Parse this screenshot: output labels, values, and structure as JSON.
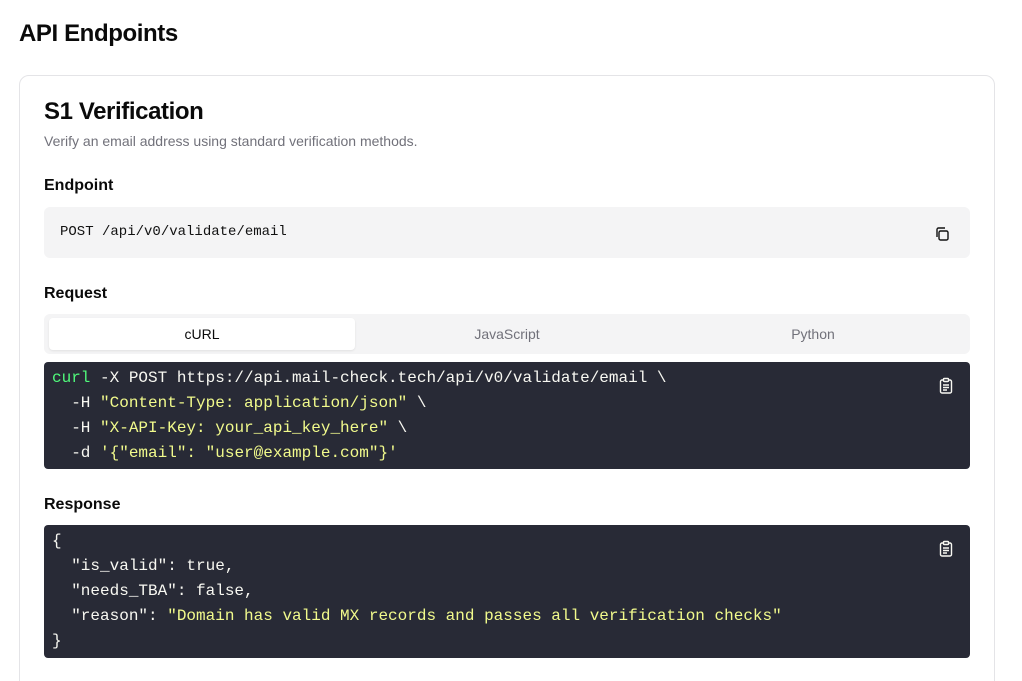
{
  "page": {
    "title": "API Endpoints"
  },
  "card": {
    "title": "S1 Verification",
    "description": "Verify an email address using standard verification methods."
  },
  "endpoint": {
    "label": "Endpoint",
    "value": "POST /api/v0/validate/email",
    "copy_icon": "copy-icon"
  },
  "request": {
    "label": "Request",
    "tabs": [
      {
        "label": "cURL",
        "active": true
      },
      {
        "label": "JavaScript",
        "active": false
      },
      {
        "label": "Python",
        "active": false
      }
    ],
    "code": {
      "l1_cmd": "curl",
      "l1_rest": " -X POST https://api.mail-check.tech/api/v0/validate/email \\",
      "l2_flag": "  -H ",
      "l2_str": "\"Content-Type: application/json\"",
      "l2_end": " \\",
      "l3_flag": "  -H ",
      "l3_str": "\"X-API-Key: your_api_key_here\"",
      "l3_end": " \\",
      "l4_flag": "  -d ",
      "l4_str": "'{\"email\": \"user@example.com\"}'"
    },
    "copy_icon": "clipboard-icon"
  },
  "response": {
    "label": "Response",
    "code": {
      "l1": "{",
      "l2": "  \"is_valid\": true,",
      "l3": "  \"needs_TBA\": false,",
      "l4_key": "  \"reason\": ",
      "l4_str": "\"Domain has valid MX records and passes all verification checks\"",
      "l5": "}"
    },
    "copy_icon": "clipboard-icon"
  },
  "colors": {
    "code_bg": "#282a36",
    "code_text": "#f8f8f2",
    "code_keyword": "#50fa7b",
    "code_string": "#f1fa8c",
    "muted_bg": "#f4f4f5",
    "muted_text": "#71717a"
  }
}
